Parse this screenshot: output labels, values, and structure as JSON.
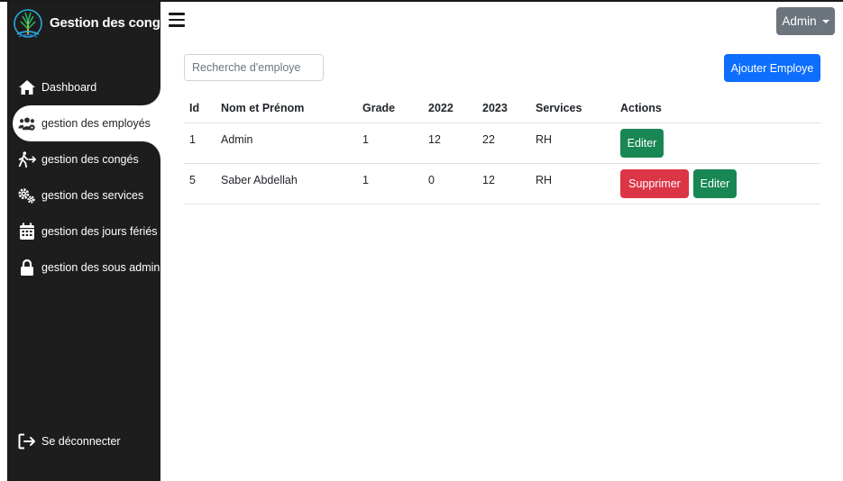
{
  "sidebar": {
    "brand_title": "Gestion des congés",
    "items": [
      {
        "label": "Dashboard",
        "icon": "home-icon"
      },
      {
        "label": "gestion des employés",
        "icon": "users-icon"
      },
      {
        "label": "gestion des congés",
        "icon": "walking-icon"
      },
      {
        "label": "gestion des services",
        "icon": "gears-icon"
      },
      {
        "label": "gestion des jours fériés",
        "icon": "calendar-icon"
      },
      {
        "label": "gestion des sous admin",
        "icon": "lock-icon"
      }
    ],
    "logout_label": "Se déconnecter"
  },
  "header": {
    "admin_label": "Admin"
  },
  "toolbar": {
    "search_placeholder": "Recherche d'employe",
    "add_label": "Ajouter Employe"
  },
  "table": {
    "headers": [
      "Id",
      "Nom et Prénom",
      "Grade",
      "2022",
      "2023",
      "Services",
      "Actions"
    ],
    "rows": [
      {
        "id": "1",
        "name": "Admin",
        "grade": "1",
        "y2022": "12",
        "y2023": "22",
        "service": "RH"
      },
      {
        "id": "5",
        "name": "Saber Abdellah",
        "grade": "1",
        "y2022": "0",
        "y2023": "12",
        "service": "RH"
      }
    ],
    "delete_label": "Supprimer",
    "edit_label": "Editer"
  },
  "colors": {
    "sidebar_bg": "#1d1d1d",
    "primary": "#0d6efd",
    "success": "#198754",
    "danger": "#dc3545",
    "secondary": "#6c757d"
  }
}
